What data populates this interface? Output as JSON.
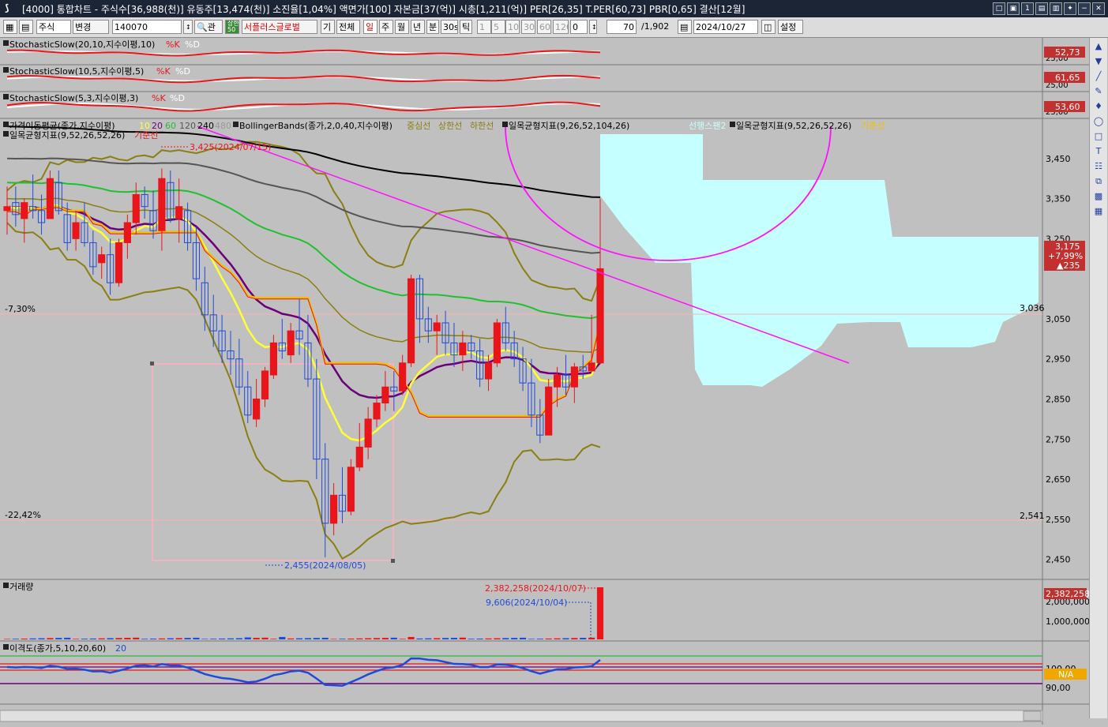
{
  "window": {
    "logo": "⟆",
    "title": "[4000] 통합차트 - 주식수[36,988(천)] 유동주[13,474(천)] 소진율[1,04%] 액면가[100] 자본금[37(억)] 시총[1,211(억)] PER[26,35] T.PER[60,73] PBR[0,65] 결산[12월]",
    "buttons": [
      "□",
      "▣",
      "1",
      "▤",
      "▥",
      "✦",
      "−",
      "✕"
    ]
  },
  "toolbar": {
    "market": "주식",
    "change": "변경",
    "code": "140070",
    "search_label": "관",
    "badge": "상한\n50",
    "stock_name": "서플러스글로벌",
    "btn_gi": "기",
    "btn_all": "전체",
    "periods": [
      "일",
      "주",
      "월",
      "년",
      "분",
      "30s",
      "틱"
    ],
    "minute_opts": [
      "1",
      "5",
      "10",
      "30",
      "60",
      "120"
    ],
    "offset": "0",
    "count": "70",
    "total": "/1,902",
    "date": "2024/10/27",
    "settings": "설정"
  },
  "panels": {
    "stoch1": {
      "label": "StochasticSlow(20,10,지수이평,10)",
      "k": "%K",
      "d": "%D",
      "value": "52,73",
      "axis": "25,00"
    },
    "stoch2": {
      "label": "StochasticSlow(10,5,지수이평,5)",
      "k": "%K",
      "d": "%D",
      "value": "61,65",
      "axis": "25,00"
    },
    "stoch3": {
      "label": "StochasticSlow(5,3,지수이평,3)",
      "k": "%K",
      "d": "%D",
      "value": "53,60",
      "axis": "25,00"
    },
    "price": {
      "legend1": "가격이동평균(종가,지수이평)",
      "ma_periods": [
        "10",
        "20",
        "60",
        "120",
        "240",
        "480"
      ],
      "bb_label": "BollingerBands(종가,2,0,40,지수이평)",
      "bb_lines": [
        "중심선",
        "상한선",
        "하한선"
      ],
      "ichimoku1": "일목균형지표(9,26,52,104,26)",
      "ichimoku1_extra": "선행스팬2",
      "ichimoku2": "일목균형지표(9,52,26,52,26)",
      "ichimoku2_extra": "기준선",
      "legend2": "일목균형지표(9,52,26,52,26)",
      "legend2_extra": "기준선",
      "high_note": "3,425(2024/07/15)",
      "low_note": "2,455(2024/08/05)",
      "pct_top": "-7,30%",
      "pct_bottom": "-22,42%",
      "level_top": "3,036",
      "level_bottom": "2,541",
      "axis": [
        "3,450",
        "3,350",
        "3,250",
        "3,050",
        "2,950",
        "2,850",
        "2,750",
        "2,650",
        "2,550",
        "2,450"
      ],
      "current": {
        "price": "3,175",
        "pct": "+7,99%",
        "chg": "▲235"
      }
    },
    "volume": {
      "label": "거래량",
      "note_high": "2,382,258(2024/10/07)",
      "note_low": "9,606(2024/10/04)",
      "value": "2,382,258",
      "axis": [
        "2,000,000",
        "1,000,000"
      ]
    },
    "disparity": {
      "label": "이격도(종가,5,10,20,60)",
      "period": "20",
      "value": "N/A",
      "axis": [
        "100,00",
        "90,00"
      ]
    }
  },
  "colors": {
    "bg": "#c0c0c0",
    "up": "#e8151b",
    "down": "#1f4bd8",
    "cloud": "#c6ffff",
    "ma10": "#ffff33",
    "ma20": "#6b007a",
    "ma60": "#20c030",
    "ma120": "#555555",
    "ma240": "#000000",
    "bb": "#8a7f10",
    "trend": "#ff10ff",
    "kijun": "#f0c000"
  },
  "chart_data": {
    "type": "candlestick",
    "title": "서플러스글로벌 (140070) 일봉",
    "ylim": [
      2400,
      3550
    ],
    "candles_ohlc": [
      [
        3320,
        3380,
        3260,
        3330
      ],
      [
        3340,
        3380,
        3280,
        3310
      ],
      [
        3300,
        3350,
        3240,
        3340
      ],
      [
        3330,
        3410,
        3300,
        3320
      ],
      [
        3320,
        3360,
        3260,
        3290
      ],
      [
        3300,
        3420,
        3300,
        3400
      ],
      [
        3390,
        3420,
        3310,
        3320
      ],
      [
        3310,
        3340,
        3220,
        3240
      ],
      [
        3250,
        3320,
        3220,
        3290
      ],
      [
        3290,
        3340,
        3230,
        3240
      ],
      [
        3240,
        3270,
        3160,
        3180
      ],
      [
        3190,
        3230,
        3150,
        3210
      ],
      [
        3210,
        3250,
        3110,
        3140
      ],
      [
        3140,
        3250,
        3130,
        3240
      ],
      [
        3240,
        3310,
        3200,
        3290
      ],
      [
        3290,
        3390,
        3260,
        3360
      ],
      [
        3360,
        3380,
        3300,
        3330
      ],
      [
        3320,
        3370,
        3250,
        3270
      ],
      [
        3270,
        3425,
        3220,
        3400
      ],
      [
        3390,
        3420,
        3290,
        3300
      ],
      [
        3300,
        3400,
        3240,
        3330
      ],
      [
        3320,
        3340,
        3220,
        3240
      ],
      [
        3240,
        3280,
        3120,
        3150
      ],
      [
        3140,
        3180,
        3020,
        3060
      ],
      [
        3060,
        3110,
        2980,
        3020
      ],
      [
        3020,
        3060,
        2940,
        2970
      ],
      [
        2970,
        3020,
        2910,
        2950
      ],
      [
        2950,
        3000,
        2860,
        2880
      ],
      [
        2880,
        2920,
        2790,
        2810
      ],
      [
        2800,
        2900,
        2780,
        2850
      ],
      [
        2850,
        2930,
        2830,
        2920
      ],
      [
        2910,
        3010,
        2900,
        2990
      ],
      [
        2990,
        3050,
        2950,
        2970
      ],
      [
        2960,
        3040,
        2940,
        3020
      ],
      [
        3020,
        3100,
        2960,
        3000
      ],
      [
        2990,
        3060,
        2880,
        2900
      ],
      [
        2900,
        2950,
        2650,
        2700
      ],
      [
        2700,
        2740,
        2455,
        2540
      ],
      [
        2540,
        2640,
        2510,
        2610
      ],
      [
        2610,
        2680,
        2540,
        2570
      ],
      [
        2570,
        2700,
        2560,
        2680
      ],
      [
        2680,
        2790,
        2670,
        2730
      ],
      [
        2730,
        2830,
        2700,
        2800
      ],
      [
        2800,
        2860,
        2780,
        2840
      ],
      [
        2840,
        2920,
        2820,
        2880
      ],
      [
        2880,
        2920,
        2820,
        2870
      ],
      [
        2870,
        2960,
        2860,
        2940
      ],
      [
        2940,
        3160,
        2930,
        3150
      ],
      [
        3150,
        3160,
        2990,
        3050
      ],
      [
        3050,
        3080,
        2990,
        3020
      ],
      [
        3020,
        3060,
        2960,
        3040
      ],
      [
        3040,
        3070,
        2960,
        2990
      ],
      [
        2990,
        3040,
        2930,
        2960
      ],
      [
        2960,
        3020,
        2920,
        2990
      ],
      [
        2990,
        3010,
        2950,
        2970
      ],
      [
        2970,
        3000,
        2880,
        2900
      ],
      [
        2900,
        2960,
        2870,
        2940
      ],
      [
        2940,
        3050,
        2930,
        3040
      ],
      [
        3040,
        3080,
        2970,
        2990
      ],
      [
        2990,
        3020,
        2930,
        2950
      ],
      [
        2950,
        2980,
        2870,
        2890
      ],
      [
        2890,
        2950,
        2780,
        2810
      ],
      [
        2810,
        2850,
        2740,
        2760
      ],
      [
        2760,
        2900,
        2760,
        2880
      ],
      [
        2880,
        2930,
        2830,
        2910
      ],
      [
        2910,
        2960,
        2860,
        2880
      ],
      [
        2880,
        2940,
        2840,
        2930
      ],
      [
        2930,
        2960,
        2900,
        2920
      ],
      [
        2920,
        3060,
        2920,
        2940
      ],
      [
        2940,
        3350,
        2940,
        3175
      ]
    ],
    "volume_last": 2382258,
    "volume_prev": 9606
  }
}
